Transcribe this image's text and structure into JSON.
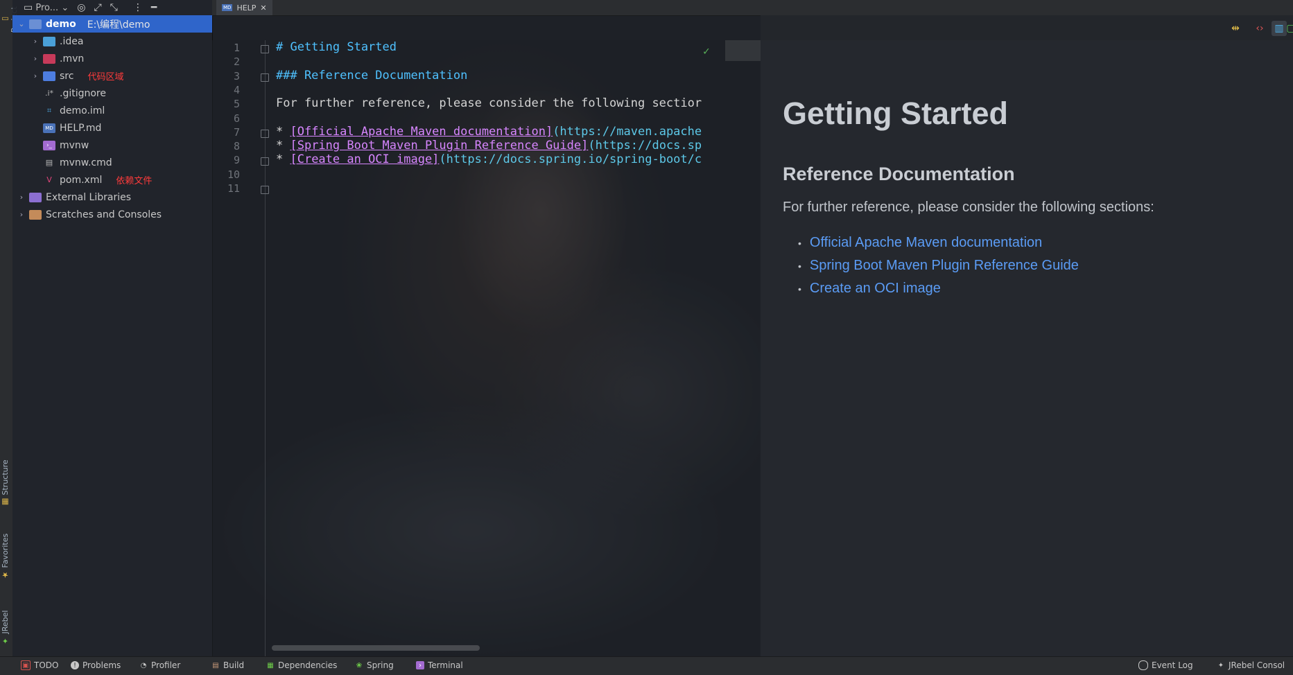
{
  "project_panel": {
    "header_label": "Pro...",
    "tree": [
      {
        "label": "demo",
        "path": "E:\\编程\\demo",
        "depth": 0,
        "expanded": true,
        "selected": true,
        "icon": "module-folder-icon"
      },
      {
        "label": ".idea",
        "depth": 1,
        "expanded": false,
        "icon": "folder-icon"
      },
      {
        "label": ".mvn",
        "depth": 1,
        "expanded": false,
        "icon": "folder-icon"
      },
      {
        "label": "src",
        "depth": 1,
        "expanded": false,
        "icon": "source-folder-icon",
        "annotation": "代码区域"
      },
      {
        "label": ".gitignore",
        "depth": 1,
        "icon": "gitignore-file-icon"
      },
      {
        "label": "demo.iml",
        "depth": 1,
        "icon": "iml-file-icon"
      },
      {
        "label": "HELP.md",
        "depth": 1,
        "icon": "markdown-file-icon"
      },
      {
        "label": "mvnw",
        "depth": 1,
        "icon": "terminal-file-icon"
      },
      {
        "label": "mvnw.cmd",
        "depth": 1,
        "icon": "cmd-file-icon"
      },
      {
        "label": "pom.xml",
        "depth": 1,
        "icon": "maven-file-icon",
        "annotation": "依赖文件"
      },
      {
        "label": "External Libraries",
        "depth": 0,
        "expanded": false,
        "icon": "library-icon"
      },
      {
        "label": "Scratches and Consoles",
        "depth": 0,
        "expanded": false,
        "icon": "scratch-icon"
      }
    ]
  },
  "left_strip": {
    "project": "Project",
    "structure": "Structure",
    "favorites": "Favorites",
    "jrebel": "JRebel"
  },
  "editor": {
    "tab_label": "HELP",
    "tab_icon_text": "MD",
    "line_numbers": [
      "1",
      "2",
      "3",
      "4",
      "5",
      "6",
      "7",
      "8",
      "9",
      "10",
      "11"
    ],
    "lines": [
      {
        "n": 1,
        "text": "# Getting Started",
        "kind": "heading"
      },
      {
        "n": 3,
        "text": "### Reference Documentation",
        "kind": "heading"
      },
      {
        "n": 5,
        "text": "For further reference, please consider the following sectior",
        "kind": "plain"
      },
      {
        "n": 7,
        "link": "[Official Apache Maven documentation]",
        "url": "(https://maven.apache"
      },
      {
        "n": 8,
        "link": "[Spring Boot Maven Plugin Reference Guide]",
        "url": "(https://docs.sp"
      },
      {
        "n": 9,
        "link": "[Create an OCI image]",
        "url": "(https://docs.spring.io/spring-boot/c"
      }
    ]
  },
  "preview": {
    "h1": "Getting Started",
    "h2": "Reference Documentation",
    "paragraph": "For further reference, please consider the following sections:",
    "links": [
      "Official Apache Maven documentation",
      "Spring Boot Maven Plugin Reference Guide",
      "Create an OCI image"
    ]
  },
  "statusbar": {
    "todo": "TODO",
    "problems": "Problems",
    "profiler": "Profiler",
    "build": "Build",
    "dependencies": "Dependencies",
    "spring": "Spring",
    "terminal": "Terminal",
    "event_log": "Event Log",
    "jrebel_console": "JRebel Consol"
  },
  "colors": {
    "selection": "#2f65ca",
    "heading": "#4fc1ff",
    "link": "#d786ff",
    "url": "#5dc8e8",
    "preview_link": "#5b9cf5",
    "annotation": "#ff3b3b"
  }
}
